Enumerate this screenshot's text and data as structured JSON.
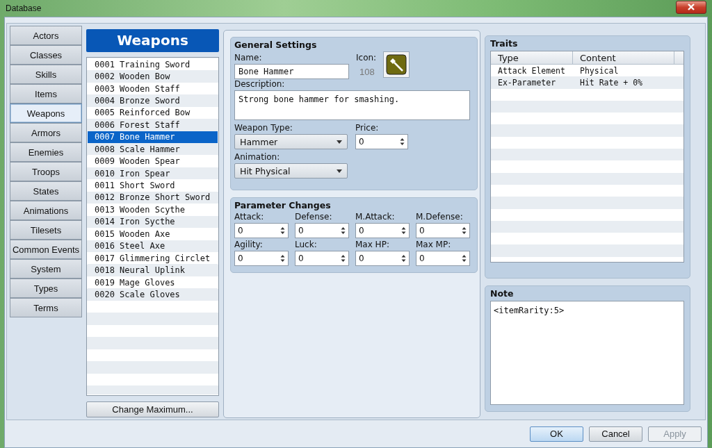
{
  "window": {
    "title": "Database"
  },
  "categories": [
    {
      "label": "Actors",
      "selected": false
    },
    {
      "label": "Classes",
      "selected": false
    },
    {
      "label": "Skills",
      "selected": false
    },
    {
      "label": "Items",
      "selected": false
    },
    {
      "label": "Weapons",
      "selected": true
    },
    {
      "label": "Armors",
      "selected": false
    },
    {
      "label": "Enemies",
      "selected": false
    },
    {
      "label": "Troops",
      "selected": false
    },
    {
      "label": "States",
      "selected": false
    },
    {
      "label": "Animations",
      "selected": false
    },
    {
      "label": "Tilesets",
      "selected": false
    },
    {
      "label": "Common Events",
      "selected": false
    },
    {
      "label": "System",
      "selected": false
    },
    {
      "label": "Types",
      "selected": false
    },
    {
      "label": "Terms",
      "selected": false
    }
  ],
  "list": {
    "title": "Weapons",
    "button": "Change Maximum...",
    "items": [
      {
        "label": "0001 Training Sword",
        "selected": false
      },
      {
        "label": "0002 Wooden Bow",
        "selected": false
      },
      {
        "label": "0003 Wooden Staff",
        "selected": false
      },
      {
        "label": "0004 Bronze Sword",
        "selected": false
      },
      {
        "label": "0005 Reinforced Bow",
        "selected": false
      },
      {
        "label": "0006 Forest Staff",
        "selected": false
      },
      {
        "label": "0007 Bone Hammer",
        "selected": true
      },
      {
        "label": "0008 Scale Hammer",
        "selected": false
      },
      {
        "label": "0009 Wooden Spear",
        "selected": false
      },
      {
        "label": "0010 Iron Spear",
        "selected": false
      },
      {
        "label": "0011 Short Sword",
        "selected": false
      },
      {
        "label": "0012 Bronze Short Sword",
        "selected": false
      },
      {
        "label": "0013 Wooden Scythe",
        "selected": false
      },
      {
        "label": "0014 Iron Sycthe",
        "selected": false
      },
      {
        "label": "0015 Wooden Axe",
        "selected": false
      },
      {
        "label": "0016 Steel Axe",
        "selected": false
      },
      {
        "label": "0017 Glimmering Circlet",
        "selected": false
      },
      {
        "label": "0018 Neural Uplink",
        "selected": false
      },
      {
        "label": "0019 Mage Gloves",
        "selected": false
      },
      {
        "label": "0020 Scale Gloves",
        "selected": false
      }
    ]
  },
  "general": {
    "title": "General Settings",
    "name": {
      "label": "Name:",
      "value": "Bone Hammer"
    },
    "icon": {
      "label": "Icon:",
      "index": "108"
    },
    "description": {
      "label": "Description:",
      "value": "Strong bone hammer for smashing."
    },
    "weapon_type": {
      "label": "Weapon Type:",
      "value": "Hammer"
    },
    "price": {
      "label": "Price:",
      "value": "0"
    },
    "animation": {
      "label": "Animation:",
      "value": "Hit Physical"
    }
  },
  "parameters": {
    "title": "Parameter Changes",
    "fields": [
      {
        "label": "Attack:",
        "value": "0"
      },
      {
        "label": "Defense:",
        "value": "0"
      },
      {
        "label": "M.Attack:",
        "value": "0"
      },
      {
        "label": "M.Defense:",
        "value": "0"
      },
      {
        "label": "Agility:",
        "value": "0"
      },
      {
        "label": "Luck:",
        "value": "0"
      },
      {
        "label": "Max HP:",
        "value": "0"
      },
      {
        "label": "Max MP:",
        "value": "0"
      }
    ]
  },
  "traits": {
    "title": "Traits",
    "columns": [
      "Type",
      "Content"
    ],
    "rows": [
      {
        "type": "Attack Element",
        "content": "Physical"
      },
      {
        "type": "Ex-Parameter",
        "content": "Hit Rate + 0%"
      }
    ]
  },
  "note": {
    "title": "Note",
    "value": "<itemRarity:5>"
  },
  "buttons": [
    {
      "label": "OK",
      "kind": "default",
      "disabled": false
    },
    {
      "label": "Cancel",
      "kind": "normal",
      "disabled": false
    },
    {
      "label": "Apply",
      "kind": "normal",
      "disabled": true
    }
  ]
}
